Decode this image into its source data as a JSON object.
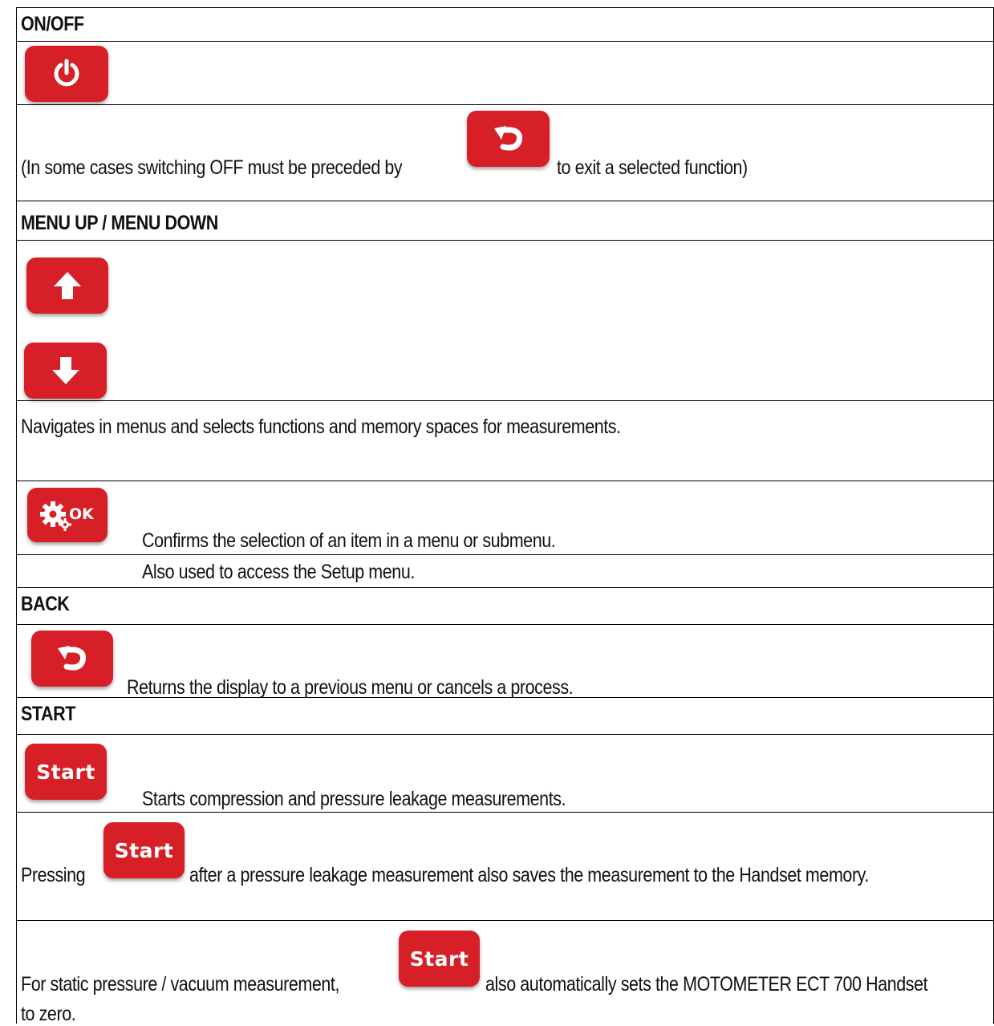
{
  "rows": {
    "on_off": {
      "heading": "ON/OFF",
      "note_before": "(In some cases switching OFF must be preceded by",
      "note_after": "to exit a selected function)"
    },
    "menu": {
      "heading": "MENU UP / MENU DOWN",
      "description": "Navigates in menus and selects functions and memory spaces for measurements."
    },
    "ok": {
      "line1": "Confirms the selection of an item in a menu or submenu.",
      "line2": "Also used to access the Setup menu.",
      "key_label": "OK"
    },
    "back": {
      "heading": "BACK",
      "description": "Returns the display to a previous menu or cancels a process."
    },
    "start": {
      "heading": "START",
      "description": "Starts compression and pressure leakage measurements.",
      "key_label": "Start",
      "pressing_before": "Pressing",
      "pressing_after": "after a pressure leakage measurement also saves the measurement to the Handset memory.",
      "static_before": "For static pressure / vacuum measurement,",
      "static_after": "also automatically sets the MOTOMETER ECT 700 Handset",
      "static_wrap": "to zero."
    }
  },
  "icons": [
    "power-icon",
    "back-icon",
    "arrow-up-icon",
    "arrow-down-icon",
    "settings-gear-icon"
  ],
  "colors": {
    "key_red": "#d61f26",
    "key_text": "#ffffff",
    "border": "#000000"
  }
}
